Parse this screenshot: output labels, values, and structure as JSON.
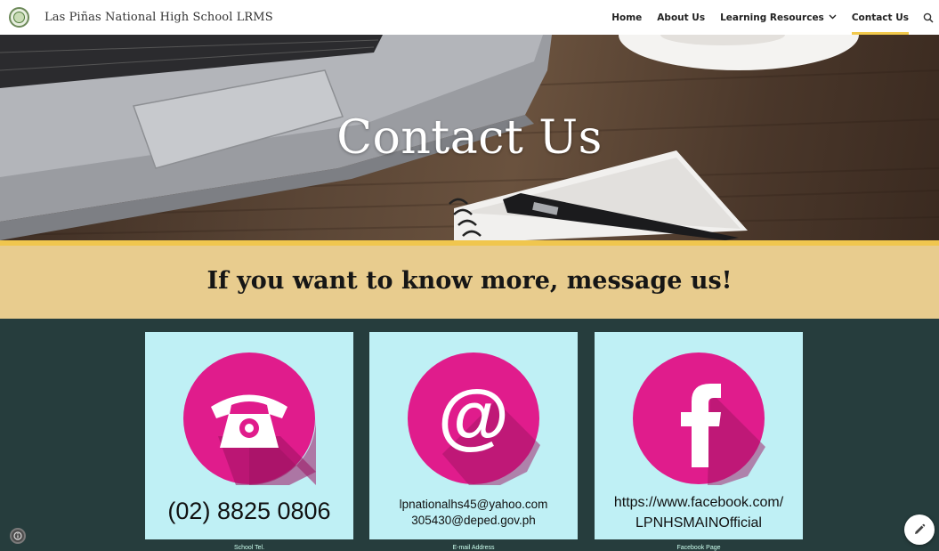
{
  "site": {
    "title": "Las Piñas National High School LRMS"
  },
  "nav": {
    "items": [
      {
        "label": "Home",
        "active": false
      },
      {
        "label": "About Us",
        "active": false
      },
      {
        "label": "Learning Resources",
        "active": false,
        "has_dropdown": true
      },
      {
        "label": "Contact Us",
        "active": true
      }
    ],
    "dropdown_icon": "chevron-down-icon",
    "search_icon": "search-icon"
  },
  "hero": {
    "title": "Contact Us"
  },
  "banner": {
    "text": "If you want to know more, message us!"
  },
  "cards": [
    {
      "icon": "telephone-icon",
      "lines": [
        "(02) 8825 0806"
      ],
      "caption": "School Tel."
    },
    {
      "icon": "at-sign-icon",
      "lines": [
        "lpnationalhs45@yahoo.com",
        "305430@deped.gov.ph"
      ],
      "caption": "E-mail Address"
    },
    {
      "icon": "facebook-icon",
      "lines": [
        "https://www.facebook.com/",
        "LPNHSMAINOfficial"
      ],
      "caption": "Facebook Page"
    }
  ],
  "colors": {
    "accent_yellow": "#f0c64e",
    "banner_bg": "#e8cc8e",
    "section_bg": "#263d3d",
    "card_bg": "#bff0f5",
    "icon_pink": "#e01c8c"
  },
  "floating": {
    "info_icon": "info-icon",
    "edit_icon": "pencil-icon"
  }
}
